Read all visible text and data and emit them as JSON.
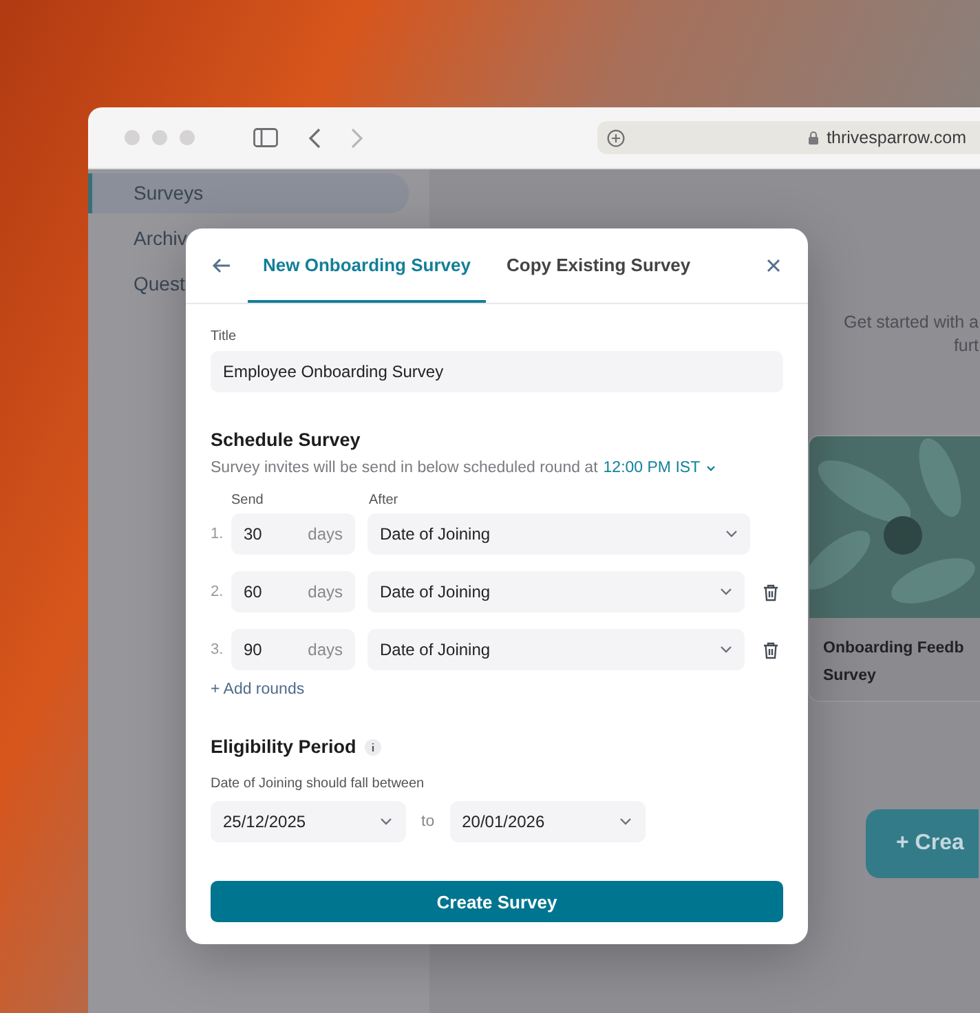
{
  "browser": {
    "url": "thrivesparrow.com",
    "forward_disabled": true
  },
  "sidebar": {
    "items": [
      {
        "label": "Surveys",
        "selected": true
      },
      {
        "label": "Archiv",
        "selected": false
      },
      {
        "label": "Quest",
        "selected": false
      }
    ]
  },
  "content": {
    "intro_lines": [
      "Get started with a",
      "furt"
    ],
    "template_card": {
      "title_lines": [
        "Onboarding Feedb",
        "Survey"
      ]
    },
    "create_button": "+ Crea"
  },
  "modal": {
    "tabs": [
      {
        "label": "New Onboarding Survey",
        "selected": true
      },
      {
        "label": "Copy Existing Survey",
        "selected": false
      }
    ],
    "title_field": {
      "label": "Title",
      "value": "Employee Onboarding Survey"
    },
    "schedule": {
      "heading": "Schedule Survey",
      "note": "Survey invites will be send in below scheduled round at",
      "time": "12:00 PM IST",
      "columns": [
        "Send",
        "After"
      ],
      "rounds": [
        {
          "number": "1.",
          "value": "30",
          "unit": "days",
          "after": "Date of Joining",
          "removable": false
        },
        {
          "number": "2.",
          "value": "60",
          "unit": "days",
          "after": "Date of Joining",
          "removable": true
        },
        {
          "number": "3.",
          "value": "90",
          "unit": "days",
          "after": "Date of Joining",
          "removable": true
        }
      ],
      "add_label": "+ Add rounds"
    },
    "eligibility": {
      "heading": "Eligibility Period",
      "note": "Date of Joining should fall between",
      "from": "25/12/2025",
      "separator": "to",
      "to": "20/01/2026"
    },
    "submit": "Create Survey"
  }
}
